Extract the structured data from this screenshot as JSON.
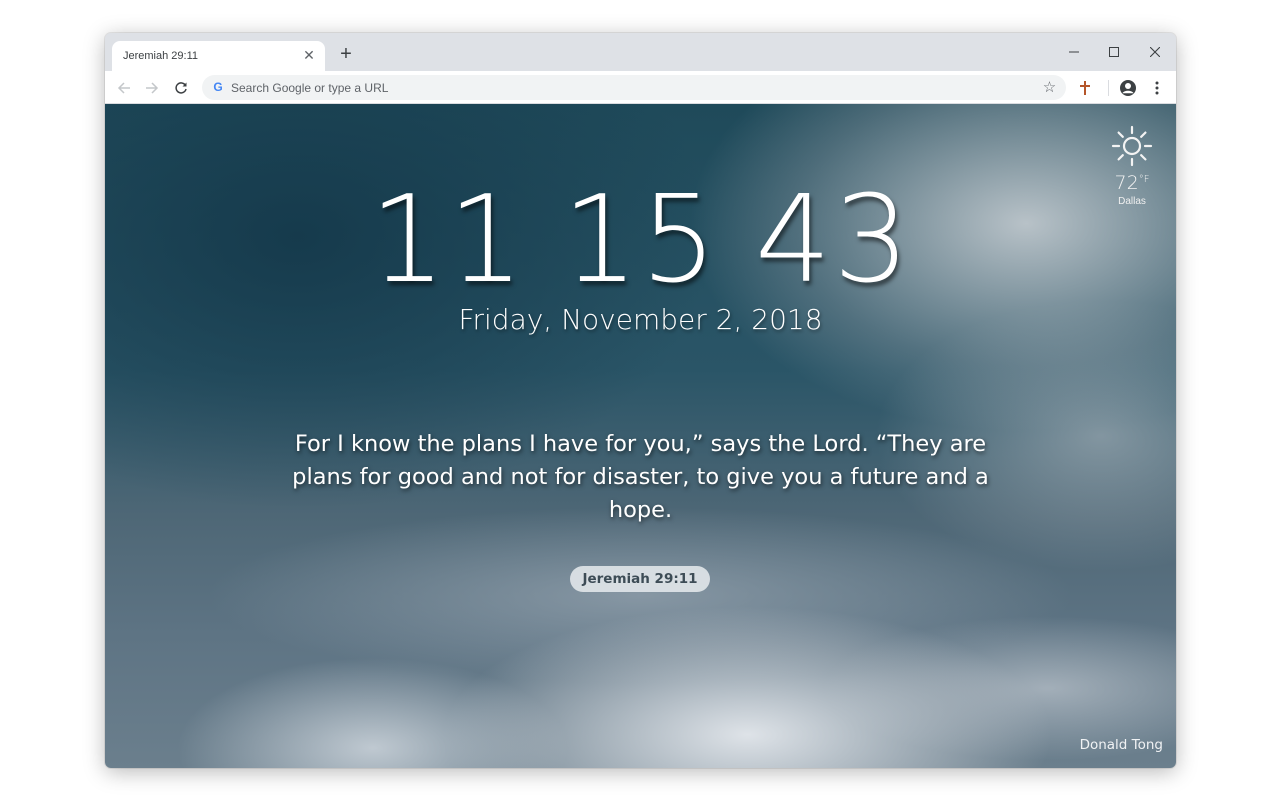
{
  "browser": {
    "tab_title": "Jeremiah 29:11",
    "new_tab_label": "+",
    "omnibox_placeholder": "Search Google or type a URL"
  },
  "newtab": {
    "clock": {
      "hours": "11",
      "minutes": "15",
      "seconds": "43"
    },
    "date": "Friday, November 2, 2018",
    "verse": "For I know the plans I have for you,” says the Lord. “They are plans for good and not for disaster, to give you a future and a hope.",
    "reference": "Jeremiah 29:11",
    "weather": {
      "temp": "72",
      "unit": "°F",
      "city": "Dallas",
      "icon": "sun-icon"
    },
    "photo_credit": "Donald Tong"
  },
  "colors": {
    "accent_extension": "#b5562a",
    "toolbar_bg": "#ffffff",
    "titlebar_bg": "#dee1e6"
  }
}
